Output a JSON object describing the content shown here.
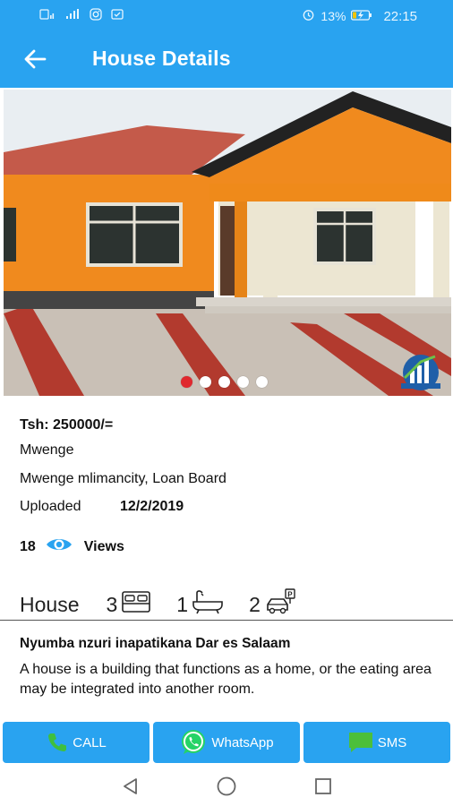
{
  "status_bar": {
    "left_icons": [
      "sim-icon",
      "signal-icon",
      "instagram-icon",
      "notification-icon"
    ],
    "battery": "13%",
    "time": "22:15"
  },
  "header": {
    "title": "House Details"
  },
  "gallery": {
    "image_count": 5,
    "active_index": 0,
    "accent_color": "#e0282e"
  },
  "listing": {
    "price": "Tsh: 250000/=",
    "area": "Mwenge",
    "address": "Mwenge mlimancity, Loan Board",
    "uploaded_label": "Uploaded",
    "uploaded_date": "12/2/2019",
    "views_count": "18",
    "views_label": "Views"
  },
  "features": {
    "type": "House",
    "bedrooms": "3",
    "bathrooms": "1",
    "parking": "2"
  },
  "description": {
    "title": "Nyumba nzuri inapatikana Dar es Salaam",
    "body": "A house is a building that functions as a home, or the eating area may be integrated into another room."
  },
  "actions": {
    "call": "CALL",
    "whatsapp": "WhatsApp",
    "sms": "SMS"
  },
  "colors": {
    "primary": "#29a3f0",
    "call_icon": "#3fbf3f",
    "whatsapp_icon": "#25d366"
  }
}
